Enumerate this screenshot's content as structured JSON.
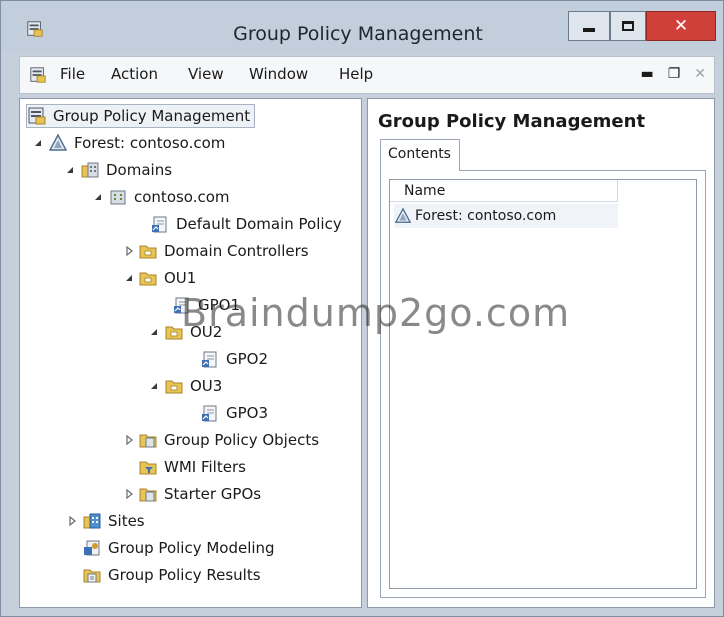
{
  "window": {
    "title": "Group Policy Management"
  },
  "menu": {
    "items": [
      "File",
      "Action",
      "View",
      "Window",
      "Help"
    ]
  },
  "tree": {
    "root": "Group Policy Management",
    "forest": "Forest: contoso.com",
    "domains": "Domains",
    "domain": "contoso.com",
    "default_policy": "Default Domain Policy",
    "domain_controllers": "Domain Controllers",
    "ou1": "OU1",
    "gpo1": "GPO1",
    "ou2": "OU2",
    "gpo2": "GPO2",
    "ou3": "OU3",
    "gpo3": "GPO3",
    "gp_objects": "Group Policy Objects",
    "wmi_filters": "WMI Filters",
    "starter_gpos": "Starter GPOs",
    "sites": "Sites",
    "modeling": "Group Policy Modeling",
    "results": "Group Policy Results"
  },
  "content": {
    "heading": "Group Policy Management",
    "tab_label": "Contents",
    "column_name": "Name",
    "rows": [
      "Forest: contoso.com"
    ]
  },
  "watermark": "Braindump2go.com"
}
